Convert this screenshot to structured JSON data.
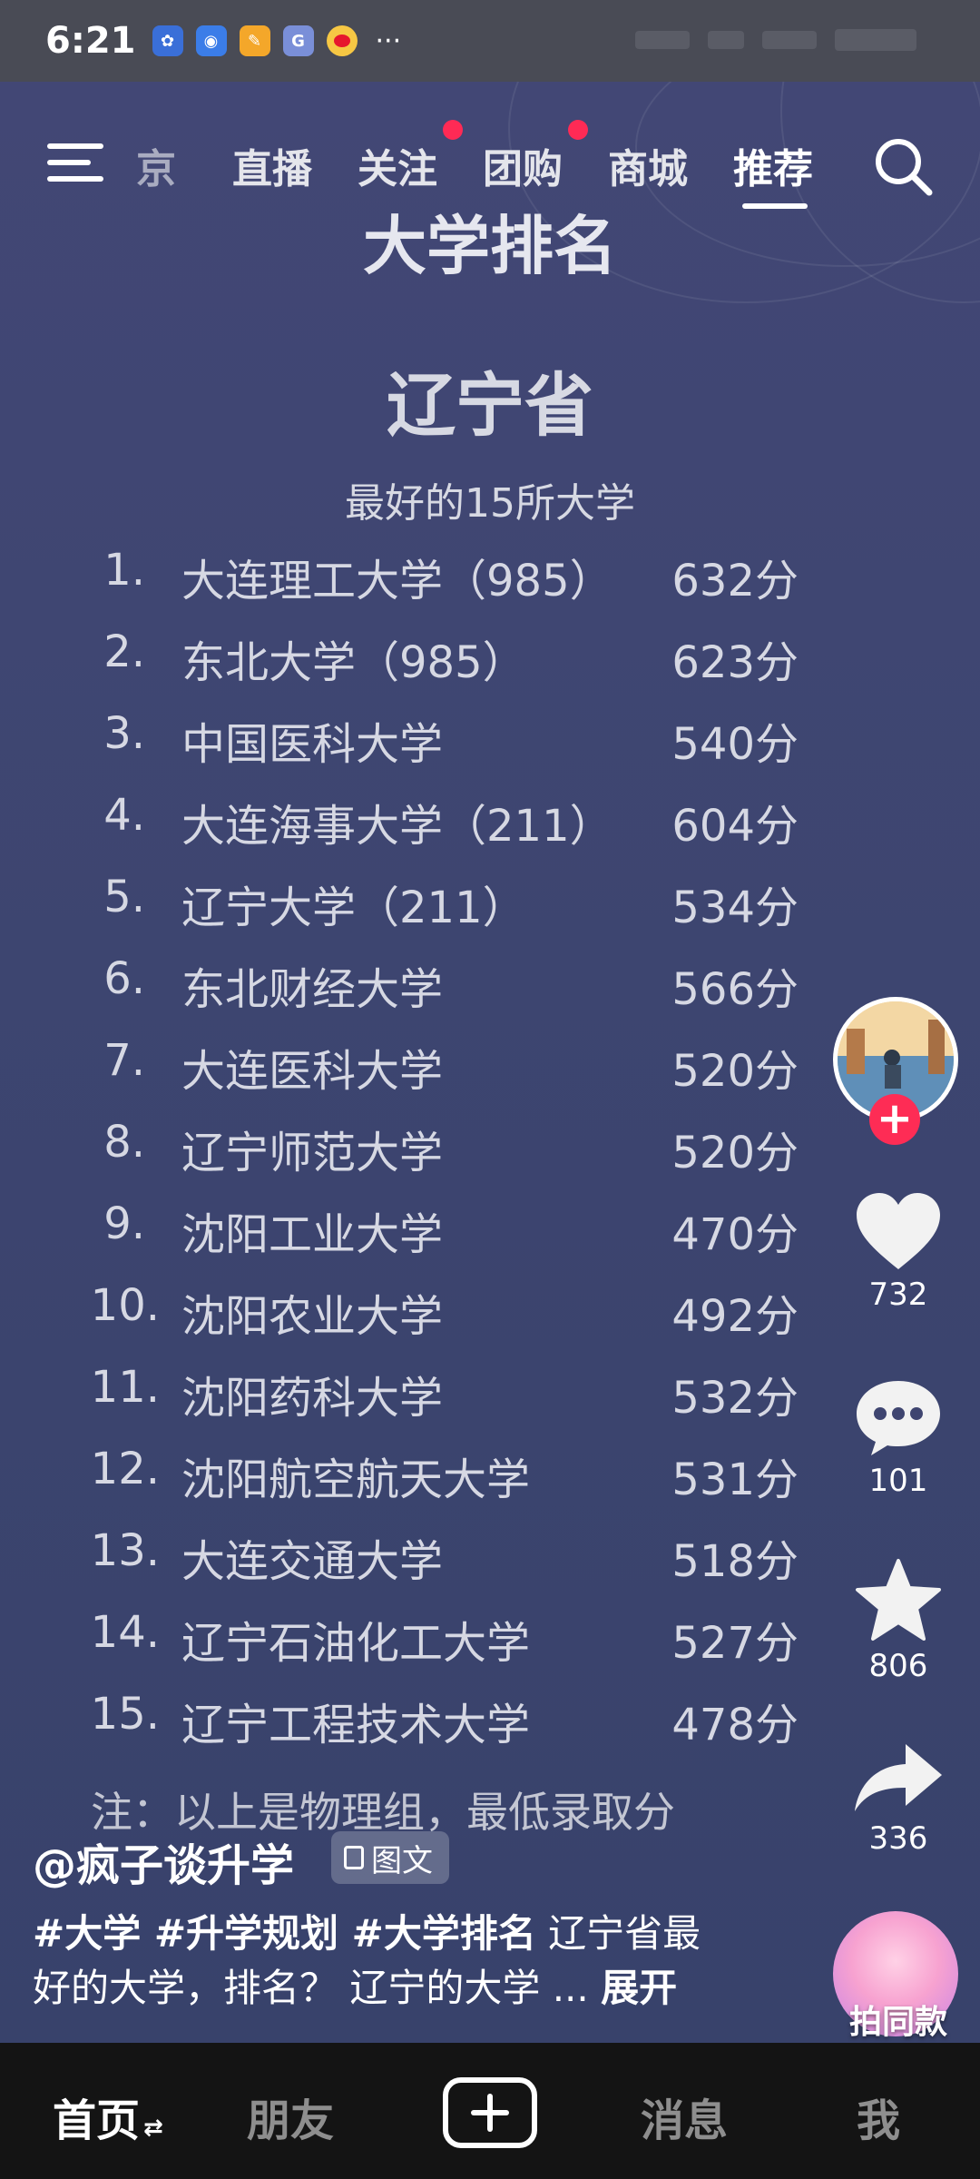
{
  "status_bar": {
    "time": "6:21",
    "more": "···"
  },
  "nav": {
    "tabs": [
      "京",
      "直播",
      "关注",
      "团购",
      "商城",
      "推荐"
    ],
    "active_tab": "推荐"
  },
  "post": {
    "title": "大学排名",
    "province": "辽宁省",
    "subtitle": "最好的15所大学",
    "rankings": [
      {
        "num": "1.",
        "name": "大连理工大学（985）",
        "score": "632分"
      },
      {
        "num": "2.",
        "name": "东北大学（985）",
        "score": "623分"
      },
      {
        "num": "3.",
        "name": "中国医科大学",
        "score": "540分"
      },
      {
        "num": "4.",
        "name": "大连海事大学（211）",
        "score": "604分"
      },
      {
        "num": "5.",
        "name": "辽宁大学（211）",
        "score": "534分"
      },
      {
        "num": "6.",
        "name": "东北财经大学",
        "score": "566分"
      },
      {
        "num": "7.",
        "name": "大连医科大学",
        "score": "520分"
      },
      {
        "num": "8.",
        "name": "辽宁师范大学",
        "score": "520分"
      },
      {
        "num": "9.",
        "name": "沈阳工业大学",
        "score": "470分"
      },
      {
        "num": "10.",
        "name": "沈阳农业大学",
        "score": "492分"
      },
      {
        "num": "11.",
        "name": "沈阳药科大学",
        "score": "532分"
      },
      {
        "num": "12.",
        "name": "沈阳航空航天大学",
        "score": "531分"
      },
      {
        "num": "13.",
        "name": "大连交通大学",
        "score": "518分"
      },
      {
        "num": "14.",
        "name": "辽宁石油化工大学",
        "score": "527分"
      },
      {
        "num": "15.",
        "name": "辽宁工程技术大学",
        "score": "478分"
      }
    ],
    "note": "注：以上是物理组，最低录取分"
  },
  "side_actions": {
    "likes": "732",
    "comments": "101",
    "favorites": "806",
    "shares": "336",
    "same_style_label": "拍同款"
  },
  "caption": {
    "author": "@疯子谈升学",
    "badge": "图文",
    "tags": "#大学 #升学规划 #大学排名",
    "text_line1_rest": " 辽宁省最",
    "text_line2": "好的大学，排名？ 辽宁的大学 ... ",
    "expand": "展开"
  },
  "bottom_nav": {
    "home": "首页",
    "friends": "朋友",
    "messages": "消息",
    "me": "我"
  },
  "colors": {
    "like_red": "#fe2c55",
    "background": "#3f4570",
    "bottom_bar": "#141414"
  }
}
